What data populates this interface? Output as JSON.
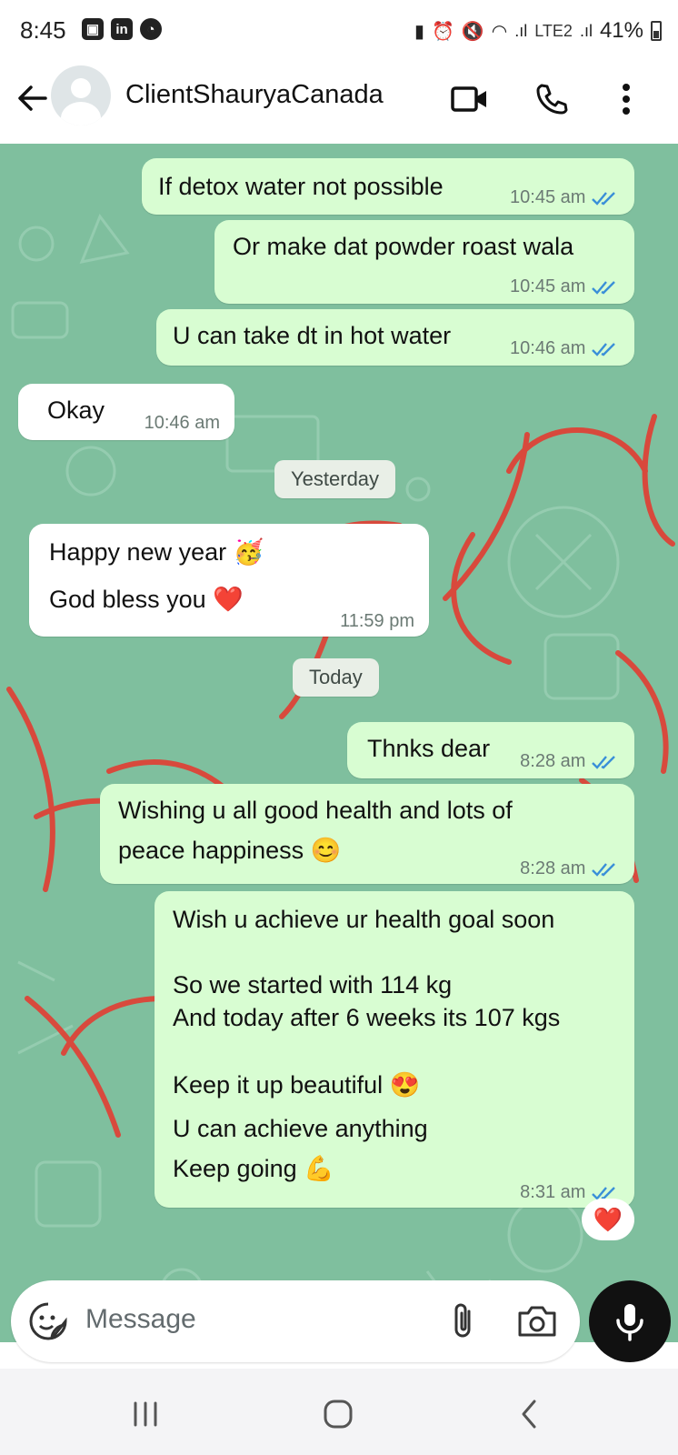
{
  "status_bar": {
    "time": "8:45",
    "left_icons": [
      "gallery-icon",
      "linkedin-icon",
      "chat-icon"
    ],
    "network": "LTE2",
    "battery": "41%"
  },
  "header": {
    "contact_name": "ClientShauryaCanada",
    "actions": [
      "video-call-icon",
      "voice-call-icon",
      "more-options-icon"
    ]
  },
  "messages": [
    {
      "dir": "out",
      "text": "If detox water not possible",
      "time": "10:45 am",
      "read": true
    },
    {
      "dir": "out",
      "text": "Or make dat powder roast wala",
      "time": "10:45 am",
      "read": true
    },
    {
      "dir": "out",
      "text": "U can take dt in hot water",
      "time": "10:46 am",
      "read": true
    },
    {
      "dir": "in",
      "text": "Okay",
      "time": "10:46 am"
    },
    {
      "dir": "in",
      "lines": [
        "Happy new year 🥳",
        "God bless you ❤️"
      ],
      "time": "11:59 pm"
    },
    {
      "dir": "out",
      "text": "Thnks dear",
      "time": "8:28 am",
      "read": true
    },
    {
      "dir": "out",
      "lines": [
        "Wishing u all good health and lots of",
        "peace happiness 😊"
      ],
      "time": "8:28 am",
      "read": true
    },
    {
      "dir": "out",
      "lines": [
        "Wish u achieve ur health goal soon",
        "",
        "So we started with 114 kg",
        "And today after 6 weeks its 107 kgs",
        "",
        "Keep it up beautiful 😍",
        "U can achieve anything",
        "Keep going 💪"
      ],
      "time": "8:31 am",
      "read": true,
      "reaction": "❤️"
    }
  ],
  "date_separators": [
    "Yesterday",
    "Today"
  ],
  "composer": {
    "placeholder": "Message"
  },
  "colors": {
    "chat_bg": "#7fbf9e",
    "outgoing_bubble": "#d8fdd2",
    "incoming_bubble": "#ffffff",
    "read_ticks": "#3a8fd8",
    "mic_button": "#111111"
  }
}
